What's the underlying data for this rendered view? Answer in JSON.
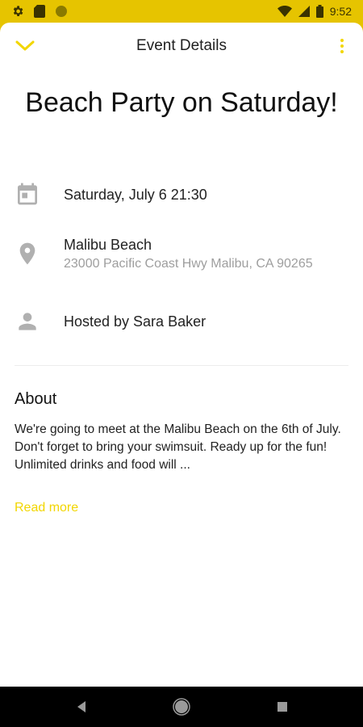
{
  "status_bar": {
    "time": "9:52",
    "icons": [
      "settings-icon",
      "sim-card-icon",
      "circle-icon",
      "wifi-icon",
      "signal-icon",
      "battery-icon"
    ]
  },
  "app_bar": {
    "title": "Event Details",
    "back_icon": "chevron-down-icon",
    "menu_icon": "more-vertical-icon"
  },
  "event": {
    "title": "Beach Party on Saturday!",
    "datetime": "Saturday, July 6 21:30",
    "location_name": "Malibu Beach",
    "location_address": "23000 Pacific Coast Hwy Malibu, CA 90265",
    "host": "Hosted by Sara Baker"
  },
  "about": {
    "heading": "About",
    "text": "We're going to meet at the Malibu Beach on the 6th of July. Don't forget to bring your swimsuit. Ready up for the fun! Unlimited drinks and food will ...",
    "read_more": "Read more"
  },
  "colors": {
    "accent": "#f2d600",
    "status_bar": "#e6c400",
    "icon_gray": "#b0b0b0"
  },
  "nav_bar": {
    "icons": [
      "back-triangle-icon",
      "home-circle-icon",
      "recents-square-icon"
    ]
  }
}
